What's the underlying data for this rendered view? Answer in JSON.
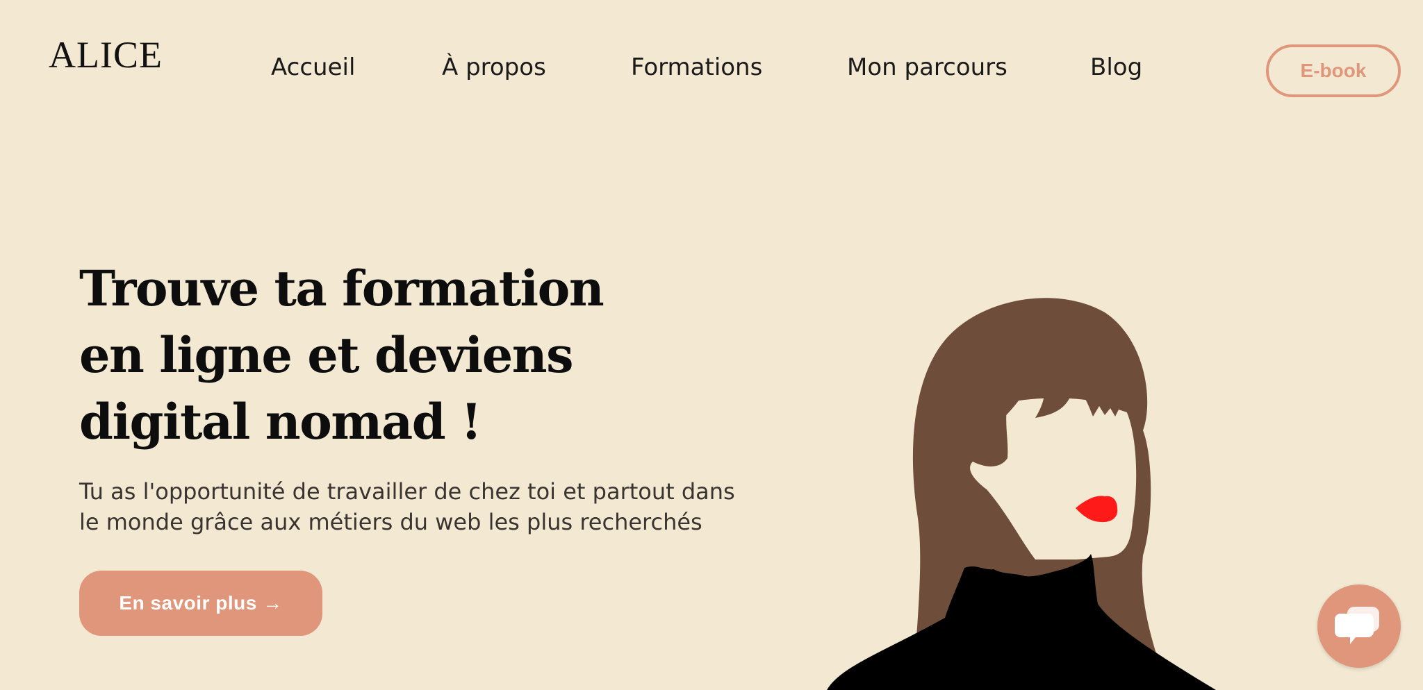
{
  "brand": {
    "logo": "ALICE"
  },
  "nav": {
    "items": [
      {
        "label": "Accueil"
      },
      {
        "label": "À propos"
      },
      {
        "label": "Formations"
      },
      {
        "label": "Mon parcours"
      },
      {
        "label": "Blog"
      }
    ],
    "cta_label": "E-book"
  },
  "hero": {
    "title": "Trouve ta formation en ligne et deviens digital nomad !",
    "subtitle": "Tu as l'opportunité de travailler de chez toi et partout dans le monde grâce aux métiers du web les plus recherchés",
    "button_label": "En savoir plus →"
  },
  "chat": {
    "icon": "chat-bubbles-icon"
  },
  "colors": {
    "background": "#f3e9d3",
    "accent": "#e0967a",
    "hair": "#6e4e3a",
    "lips": "#ff1a1a",
    "text": "#111111"
  }
}
